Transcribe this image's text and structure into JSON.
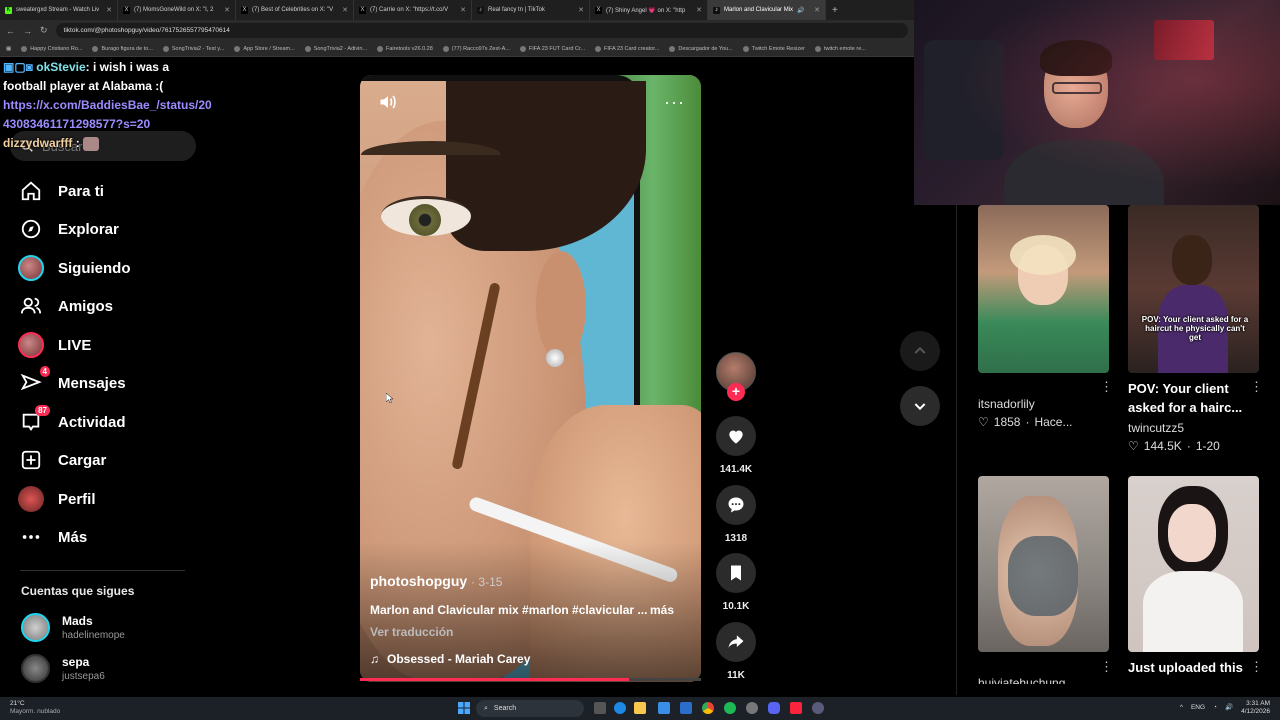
{
  "browser": {
    "tabs": [
      {
        "label": "sweatergxd Stream - Watch Liv",
        "active": false
      },
      {
        "label": "(7) MomsGoneWild on X: \"I, 2",
        "active": false
      },
      {
        "label": "(7) Best of Celebrities on X: \"V",
        "active": false
      },
      {
        "label": "(7) Carrie on X: \"https://t.co/V",
        "active": false
      },
      {
        "label": "Real fancy tn | TikTok",
        "active": false
      },
      {
        "label": "(7) Shiny Angel 💗 on X: \"http",
        "active": false
      },
      {
        "label": "Marlon and Clavicular Mix",
        "active": true
      }
    ],
    "url": "tiktok.com/@photoshopguy/video/7617526557795470614",
    "bookmarks": [
      "Happy Cristiano Ro...",
      "Burago figura de to...",
      "SongTrivia2 - Test y...",
      "App Store / Stream...",
      "SongTrivia2 - Adivin...",
      "Fairetools v26.0.28",
      "(77) Racco97s Zest-A...",
      "FIFA 23 FUT Card Cr...",
      "FIFA 23 Card creator...",
      "Descargador de You...",
      "Twitch Emote Resizer",
      "twitch emote re..."
    ]
  },
  "chat": [
    {
      "user": "okStevie",
      "text": ": i wish i was a football player at Alabama :("
    },
    {
      "user": "",
      "text": "https://x.com/BaddiesBae_/status/2043083461171298577?s=20",
      "is_link": true
    },
    {
      "user": "dizzydwarfff",
      "text": ":"
    }
  ],
  "sidebar": {
    "search_placeholder": "Buscar",
    "items": [
      {
        "label": "Para ti",
        "icon": "home-icon"
      },
      {
        "label": "Explorar",
        "icon": "compass-icon"
      },
      {
        "label": "Siguiendo",
        "icon": "avatar-icon"
      },
      {
        "label": "Amigos",
        "icon": "friends-icon"
      },
      {
        "label": "LIVE",
        "icon": "live-avatar-icon"
      },
      {
        "label": "Mensajes",
        "icon": "messages-icon",
        "badge": "4"
      },
      {
        "label": "Actividad",
        "icon": "activity-icon",
        "badge": "87"
      },
      {
        "label": "Cargar",
        "icon": "upload-icon"
      },
      {
        "label": "Perfil",
        "icon": "profile-icon"
      },
      {
        "label": "Más",
        "icon": "more-icon"
      }
    ],
    "following_title": "Cuentas que sigues",
    "following": [
      {
        "name": "Mads",
        "handle": "hadelinemope"
      },
      {
        "name": "sepa",
        "handle": "justsepa6"
      }
    ]
  },
  "video": {
    "author": "photoshopguy",
    "date": "· 3-15",
    "caption": "Marlon and Clavicular mix #marlon #clavicular ...",
    "more_label": "más",
    "translate_label": "Ver traducción",
    "sound": "Obsessed - Mariah Carey",
    "progress": 0.79,
    "likes": "141.4K",
    "comments": "1318",
    "saves": "10.1K",
    "shares": "11K"
  },
  "feed": [
    {
      "title": "",
      "user": "itsnadorlily",
      "likes": "1858",
      "time": "Hace..."
    },
    {
      "title": "POV: Your client asked for a hairc...",
      "overlay": "POV: Your client asked for a haircut he physically can't get",
      "user": "twincutzz5",
      "likes": "144.5K",
      "time": "1-20"
    },
    {
      "title": "",
      "user": "huiviatehuchung",
      "likes": "",
      "time": ""
    },
    {
      "title": "Just uploaded this",
      "user": "",
      "likes": "",
      "time": ""
    }
  ],
  "taskbar": {
    "weather_temp": "21°C",
    "weather_desc": "Mayorm. nublado",
    "search": "Search",
    "lang": "ENG",
    "time": "3:31 AM",
    "date": "4/12/2026"
  },
  "colors": {
    "accent": "#fe2c55",
    "bg": "#000000",
    "link": "#9b8cff"
  }
}
